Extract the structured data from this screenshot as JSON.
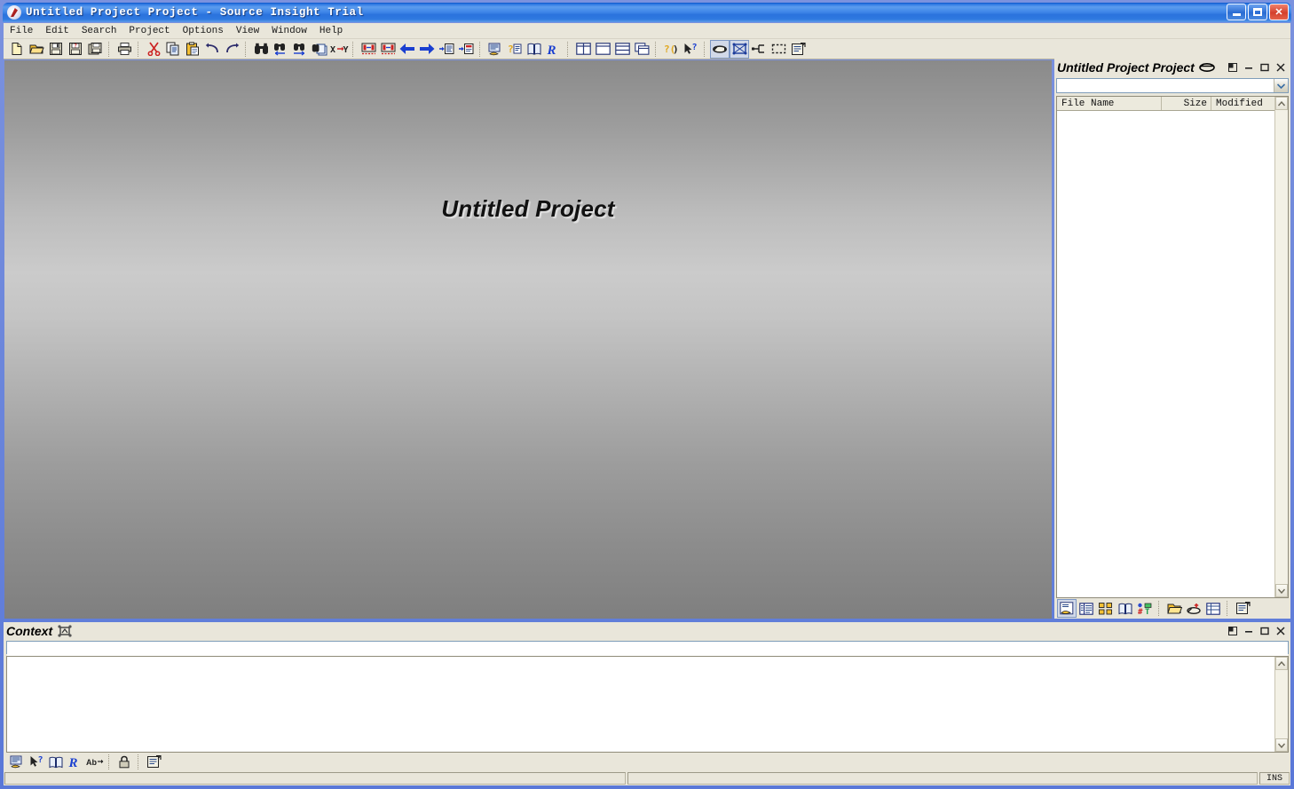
{
  "window": {
    "title": "Untitled Project Project - Source Insight Trial",
    "app_icon": "source-insight-logo-icon",
    "controls": {
      "minimize": "Minimize",
      "maximize": "Maximize",
      "close": "Close"
    }
  },
  "menubar": {
    "items": [
      {
        "label": "File"
      },
      {
        "label": "Edit"
      },
      {
        "label": "Search"
      },
      {
        "label": "Project"
      },
      {
        "label": "Options"
      },
      {
        "label": "View"
      },
      {
        "label": "Window"
      },
      {
        "label": "Help"
      }
    ]
  },
  "toolbar": {
    "groups": [
      {
        "buttons": [
          {
            "icon": "new-file-icon",
            "title": "New"
          },
          {
            "icon": "open-folder-icon",
            "title": "Open"
          },
          {
            "icon": "save-icon",
            "title": "Save"
          },
          {
            "icon": "save-as-icon",
            "title": "Save As"
          },
          {
            "icon": "save-all-icon",
            "title": "Save All"
          }
        ]
      },
      {
        "buttons": [
          {
            "icon": "print-icon",
            "title": "Print"
          }
        ]
      },
      {
        "buttons": [
          {
            "icon": "cut-scissors-icon",
            "title": "Cut"
          },
          {
            "icon": "copy-icon",
            "title": "Copy"
          },
          {
            "icon": "paste-clipboard-icon",
            "title": "Paste"
          },
          {
            "icon": "undo-arrow-icon",
            "title": "Undo"
          },
          {
            "icon": "redo-arrow-icon",
            "title": "Redo"
          }
        ]
      },
      {
        "buttons": [
          {
            "icon": "search-binoculars-icon",
            "title": "Search"
          },
          {
            "icon": "search-backward-icon",
            "title": "Search Backward"
          },
          {
            "icon": "search-forward-icon",
            "title": "Search Forward"
          },
          {
            "icon": "search-files-icon",
            "title": "Search Files"
          },
          {
            "icon": "replace-xy-icon",
            "title": "Replace"
          }
        ]
      },
      {
        "buttons": [
          {
            "icon": "jump-prev-ref-icon",
            "title": "Previous Reference"
          },
          {
            "icon": "jump-next-ref-icon",
            "title": "Next Reference"
          },
          {
            "icon": "back-arrow-icon",
            "title": "Back"
          },
          {
            "icon": "forward-arrow-icon",
            "title": "Forward"
          },
          {
            "icon": "jump-to-def-icon",
            "title": "Jump To Definition"
          },
          {
            "icon": "jump-to-caller-icon",
            "title": "Jump To Caller"
          }
        ]
      },
      {
        "buttons": [
          {
            "icon": "context-window-icon",
            "title": "Context Window"
          },
          {
            "icon": "symbol-window-icon",
            "title": "Symbol Window"
          },
          {
            "icon": "browse-project-icon",
            "title": "Browse Project Symbols"
          },
          {
            "icon": "relation-window-icon",
            "title": "Relation Window"
          }
        ]
      },
      {
        "buttons": [
          {
            "icon": "tile-windows-icon",
            "title": "Tile Windows"
          },
          {
            "icon": "tile-horizontal-icon",
            "title": "Tile Horizontally"
          },
          {
            "icon": "tile-vertical-icon",
            "title": "Tile Vertically"
          },
          {
            "icon": "cascade-windows-icon",
            "title": "Cascade Windows"
          }
        ]
      },
      {
        "buttons": [
          {
            "icon": "smart-rename-icon",
            "title": "Smart Rename"
          },
          {
            "icon": "context-help-icon",
            "title": "Context Help"
          }
        ]
      },
      {
        "buttons": [
          {
            "icon": "pointer-select-icon",
            "title": "Select Tool",
            "pressed": true
          },
          {
            "icon": "draw-box-icon",
            "title": "Draw Box",
            "pressed": true
          },
          {
            "icon": "connector-icon",
            "title": "Connector"
          },
          {
            "icon": "dashed-box-icon",
            "title": "Dashed Box"
          },
          {
            "icon": "properties-icon",
            "title": "Properties"
          }
        ]
      }
    ]
  },
  "main": {
    "splash_title": "Untitled Project"
  },
  "project_panel": {
    "title": "Untitled Project Project",
    "title_glyph": "project-symbol-icon",
    "controls": {
      "dock": "Dock",
      "minimize": "Minimize",
      "maximize": "Maximize",
      "close": "Close"
    },
    "filter_combo": {
      "value": "",
      "placeholder": ""
    },
    "columns": [
      {
        "label": "File Name"
      },
      {
        "label": "Size"
      },
      {
        "label": "Modified"
      }
    ],
    "rows": [],
    "footer_buttons": [
      {
        "icon": "open-file-in-project-icon",
        "title": "Open File",
        "pressed": true
      },
      {
        "icon": "file-list-view-icon",
        "title": "File List View"
      },
      {
        "icon": "icon-grid-view-icon",
        "title": "Icon View"
      },
      {
        "icon": "browse-symbols-icon",
        "title": "Browse Symbols"
      },
      {
        "icon": "symbol-legend-icon",
        "title": "Symbol Legend"
      },
      {
        "icon": "add-files-folder-icon",
        "title": "Add Files"
      },
      {
        "icon": "synchronize-files-icon",
        "title": "Synchronize Files"
      },
      {
        "icon": "project-report-icon",
        "title": "Project Report"
      },
      {
        "icon": "project-settings-icon",
        "title": "Project Settings"
      }
    ]
  },
  "context_panel": {
    "title": "Context",
    "title_glyph": "context-symbol-icon",
    "controls": {
      "dock": "Dock",
      "minimize": "Minimize",
      "maximize": "Maximize",
      "close": "Close"
    },
    "input": {
      "value": "",
      "placeholder": ""
    },
    "body_text": "",
    "footer_buttons": [
      {
        "icon": "context-window-icon",
        "title": "Context"
      },
      {
        "icon": "context-help-icon",
        "title": "Context Help"
      },
      {
        "icon": "browse-symbols-icon",
        "title": "Browse Symbols"
      },
      {
        "icon": "relation-window-icon",
        "title": "Relation Window"
      },
      {
        "icon": "abbreviation-icon",
        "title": "Abbreviations"
      },
      {
        "icon": "lock-icon",
        "title": "Lock Context"
      },
      {
        "icon": "properties-icon",
        "title": "Properties"
      }
    ]
  },
  "statusbar": {
    "message": "",
    "secondary": "",
    "insert_mode": "INS"
  },
  "colors": {
    "titlebar_blue": "#2f7ae4",
    "chrome_beige": "#e9e6da",
    "canvas_top_gray": "#8a8a8a",
    "canvas_mid_gray": "#c8c8c8",
    "canvas_bottom_gray": "#808080",
    "close_red": "#d3402c",
    "icon_yellow": "#ffcc33",
    "icon_blue": "#1a3fd0"
  }
}
